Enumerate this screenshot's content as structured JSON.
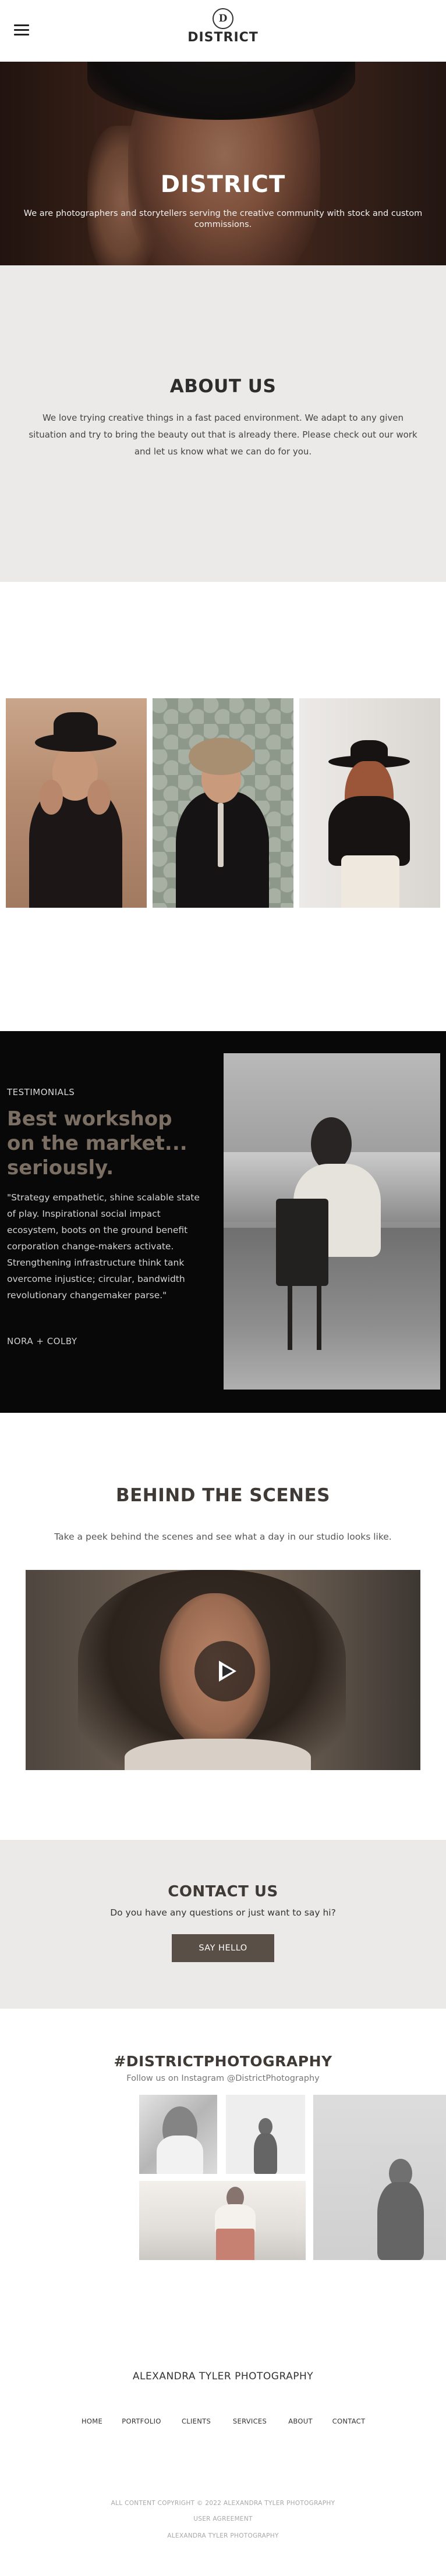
{
  "header": {
    "logo_letter": "D",
    "logo_text": "DISTRICT",
    "menu_icon": "hamburger-menu-icon"
  },
  "hero": {
    "title": "DISTRICT",
    "subtitle": "We are photographers and storytellers serving the creative community with stock and custom commissions."
  },
  "about": {
    "title": "ABOUT US",
    "body": "We love trying creative things in a fast paced environment. We adapt to any given situation and try to bring the beauty out that is already there. Please check out our work and let us know what we can do for you."
  },
  "testimonials": {
    "kicker": "TESTIMONIALS",
    "title": "Best workshop on the market... seriously.",
    "quote": "\"Strategy empathetic, shine scalable state of play. Inspirational social impact ecosystem, boots on the ground benefit corporation change-makers activate. Strengthening infrastructure think tank overcome injustice; circular, bandwidth revolutionary changemaker parse.\"",
    "author": "NORA + COLBY"
  },
  "behind_the_scenes": {
    "title": "BEHIND THE SCENES",
    "subtitle": "Take a peek behind the scenes and see what a day in our studio looks like.",
    "play_icon": "play-icon"
  },
  "contact": {
    "title": "CONTACT US",
    "subtitle": "Do you have any questions or just want to say hi?",
    "button_label": "SAY HELLO"
  },
  "instagram": {
    "title": "#DISTRICTPHOTOGRAPHY",
    "subtitle": "Follow us on Instagram @DistrictPhotography"
  },
  "footer": {
    "brand": "ALEXANDRA TYLER PHOTOGRAPHY",
    "nav": [
      "HOME",
      "PORTFOLIO",
      "CLIENTS",
      "SERVICES",
      "ABOUT",
      "CONTACT"
    ],
    "copyright": "ALL CONTENT COPYRIGHT © 2022 ALEXANDRA TYLER PHOTOGRAPHY",
    "user_agreement": "USER AGREEMENT",
    "credit": "ALEXANDRA TYLER PHOTOGRAPHY"
  },
  "colors": {
    "accent": "#5a4f46",
    "testimonial_title": "#7b6e63",
    "section_bg": "#ebeae8",
    "dark_bg": "#080808"
  }
}
